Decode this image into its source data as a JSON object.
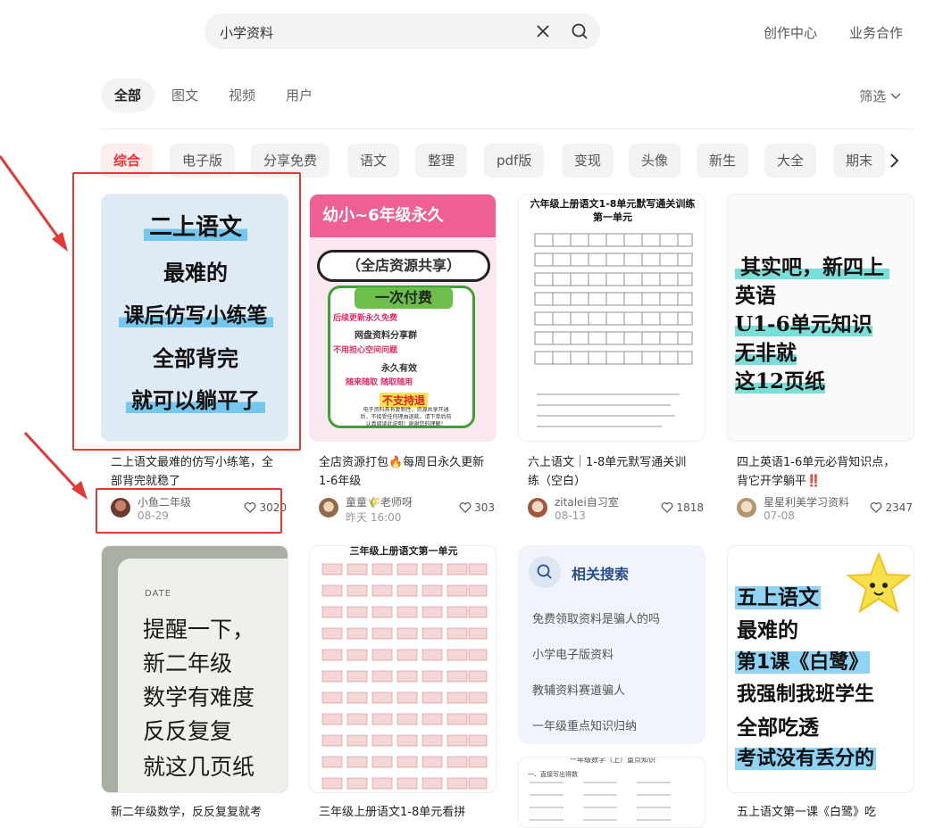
{
  "search": {
    "value": "小学资料"
  },
  "topnav": {
    "creator": "创作中心",
    "business": "业务合作"
  },
  "tabs": [
    "全部",
    "图文",
    "视频",
    "用户"
  ],
  "filter_label": "筛选",
  "chips": [
    "综合",
    "电子版",
    "分享免费",
    "语文",
    "整理",
    "pdf版",
    "变现",
    "头像",
    "新生",
    "大全",
    "期末"
  ],
  "cards": [
    {
      "cover_lines": [
        "二上语文",
        "最难的",
        "课后仿写小练笔",
        "全部背完",
        "就可以躺平了"
      ],
      "title": "二上语文最难的仿写小练笔，全部背完就稳了",
      "author": "小鱼二年级",
      "date": "08-29",
      "likes": "3020"
    },
    {
      "cover_lines": [
        "幼小~6年级永久",
        "（全店资源共享）",
        "一次付费",
        "后续更新永久免费",
        "网盘资料分享群",
        "不用担心空间问题",
        "永久有效",
        "随来随取 随取随用",
        "不支持退",
        "电子资料具有复制性，资源共享开通后，不接受任何理由退款。请下单后前认真阅读此说明！谢谢您的理解！"
      ],
      "title": "全店资源打包🔥每周日永久更新1-6年级",
      "author": "童童🌾老师呀",
      "date": "昨天 16:00",
      "likes": "303"
    },
    {
      "cover_lines": [
        "六年级上册语文1-8单元默写通关训练",
        "第一单元"
      ],
      "title": "六上语文｜1-8单元默写通关训练（空白）",
      "author": "zitalei自习室",
      "date": "08-13",
      "likes": "1818"
    },
    {
      "cover_lines": [
        "其实吧，新四上",
        "英语",
        "U1-6单元知识",
        "无非就",
        "这12页纸"
      ],
      "title": "四上英语1-6单元必背知识点，背它开学躺平‼️",
      "author": "星星利美学习资料",
      "date": "07-08",
      "likes": "2347"
    },
    {
      "cover_lines": [
        "DATE",
        "提醒一下，",
        "新二年级",
        "数学有难度",
        "反反复复",
        "就这几页纸"
      ],
      "title": "新二年级数学，反反复复就考"
    },
    {
      "cover_lines": [
        "三年级上册语文第一单元"
      ],
      "title": "三年级上册语文1-8单元看拼"
    },
    {
      "cover_lines": [
        "五上语文",
        "最难的",
        "第1课《白鹭》",
        "我强制我班学生",
        "全部吃透",
        "考试没有丢分的"
      ],
      "title": "五上语文第一课《白鹭》吃"
    }
  ],
  "related": {
    "title": "相关搜索",
    "items": [
      "免费领取资料是骗人的吗",
      "小学电子版资料",
      "教辅资料赛道骗人",
      "一年级重点知识归纳"
    ]
  },
  "partial_cover_text": [
    "一年级数学（上）重点知识",
    "一、直接写出得数"
  ]
}
